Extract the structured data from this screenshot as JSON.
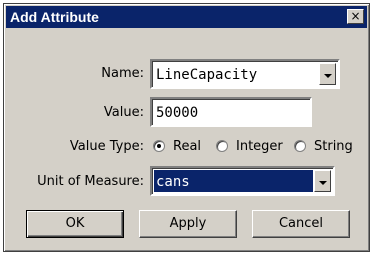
{
  "window": {
    "title": "Add Attribute",
    "close_glyph": "×"
  },
  "form": {
    "name": {
      "label": "Name:",
      "value": "LineCapacity"
    },
    "value": {
      "label": "Value:",
      "value": "50000"
    },
    "value_type": {
      "label": "Value Type:",
      "options": [
        "Real",
        "Integer",
        "String"
      ],
      "selected": "Real"
    },
    "unit": {
      "label": "Unit of Measure:",
      "value": "cans"
    }
  },
  "buttons": {
    "ok": "OK",
    "apply": "Apply",
    "cancel": "Cancel"
  },
  "colors": {
    "dialog_bg": "#d4d0c8",
    "title_bg": "#0a246a",
    "selection_bg": "#0a246a"
  }
}
